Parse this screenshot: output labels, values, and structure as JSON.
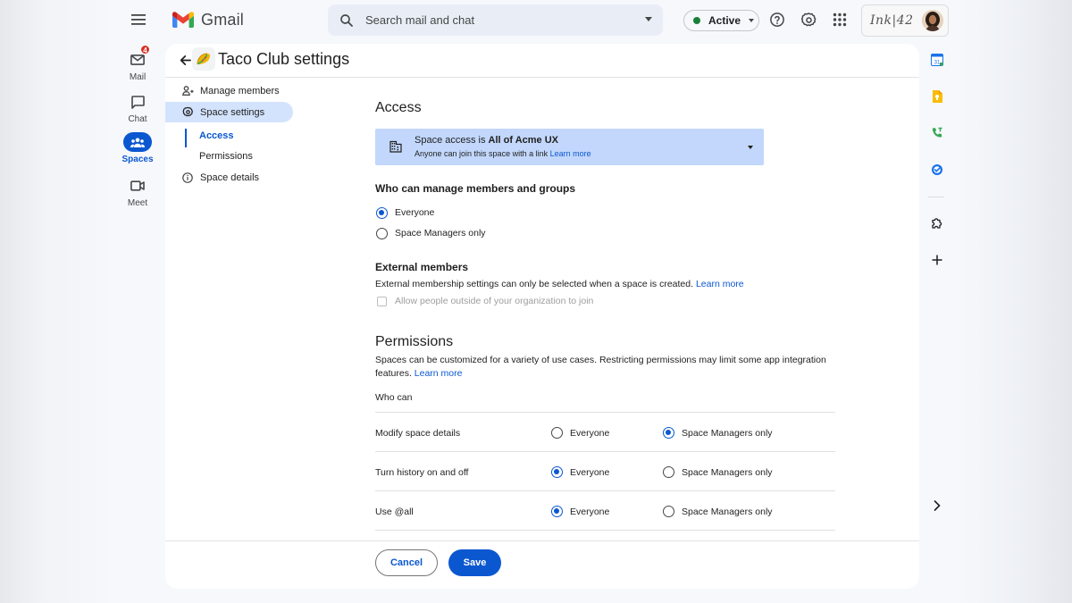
{
  "app": {
    "name": "Gmail",
    "workspace_name": "Ink|42"
  },
  "search": {
    "placeholder": "Search mail and chat"
  },
  "status": {
    "label": "Active",
    "color": "#188038"
  },
  "rail": {
    "items": [
      {
        "label": "Mail",
        "icon": "mail-icon",
        "badge": "4"
      },
      {
        "label": "Chat",
        "icon": "chat-icon"
      },
      {
        "label": "Spaces",
        "icon": "spaces-icon",
        "active": true
      },
      {
        "label": "Meet",
        "icon": "meet-icon"
      }
    ]
  },
  "page": {
    "title": "Taco Club settings",
    "space_icon": "taco-emoji"
  },
  "settings_nav": {
    "manage_members": "Manage members",
    "space_settings": "Space settings",
    "access": "Access",
    "permissions": "Permissions",
    "space_details": "Space details"
  },
  "access": {
    "heading": "Access",
    "line1_prefix": "Space access is ",
    "line1_value": "All of Acme UX",
    "line2_prefix": "Anyone can join this space with a link ",
    "line2_link": "Learn more"
  },
  "manage_members": {
    "heading": "Who can manage members and groups",
    "options": [
      "Everyone",
      "Space Managers only"
    ],
    "selected": "Everyone"
  },
  "external": {
    "heading": "External members",
    "text": "External membership settings can only be selected when a space is created. ",
    "link": "Learn more",
    "checkbox_label": "Allow people outside of your organization to join",
    "checked": false
  },
  "permissions": {
    "heading": "Permissions",
    "text": "Spaces can be customized for a variety of use cases. Restricting permissions may limit some app integration features. ",
    "link": "Learn more",
    "who_can": "Who can",
    "option_everyone": "Everyone",
    "option_managers": "Space Managers only",
    "rows": [
      {
        "label": "Modify space details",
        "selected": "Space Managers only"
      },
      {
        "label": "Turn history on and off",
        "selected": "Everyone"
      },
      {
        "label": "Use @all",
        "selected": "Everyone"
      }
    ]
  },
  "actions": {
    "cancel": "Cancel",
    "save": "Save"
  },
  "colors": {
    "accent": "#0b57d0",
    "active_nav_bg": "#d3e3fd",
    "info_box_bg": "#c2d7fb"
  }
}
